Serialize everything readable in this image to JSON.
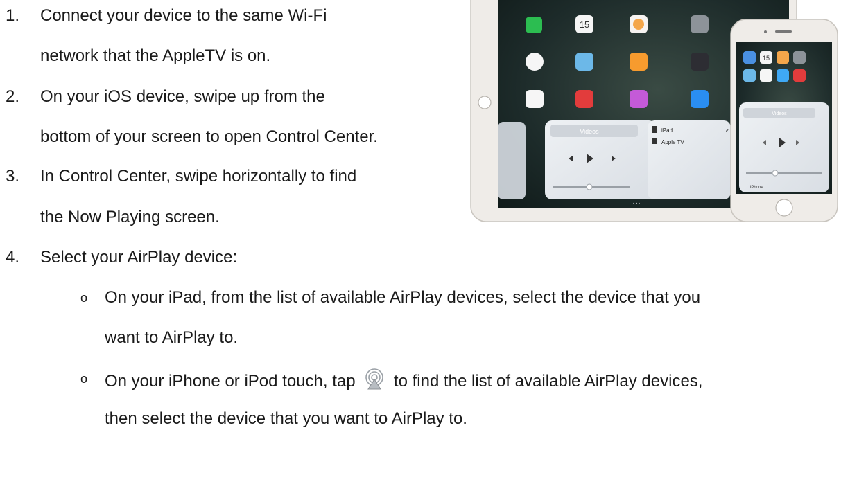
{
  "steps": [
    {
      "number": "1.",
      "lines": [
        "Connect your device to the same Wi-Fi",
        "network that the AppleTV is on."
      ]
    },
    {
      "number": "2.",
      "lines": [
        "On your iOS device, swipe up from the",
        "bottom of your screen to open Control Center."
      ]
    },
    {
      "number": "3.",
      "lines": [
        "In Control Center, swipe horizontally to find",
        "the Now Playing screen."
      ]
    },
    {
      "number": "4.",
      "lines": [
        "Select your AirPlay device:"
      ]
    }
  ],
  "sub_bullets": [
    {
      "bullet": "o",
      "lines": [
        "On your iPad, from the list of available AirPlay devices, select the device that you",
        "want to AirPlay to."
      ]
    },
    {
      "bullet": "o",
      "line1_before": "On your iPhone or iPod touch, tap",
      "line1_after": "to find the list of available AirPlay devices,",
      "line2": "then select the device that you want to AirPlay to."
    }
  ],
  "illustration": {
    "ipad": {
      "icon_labels": [
        "FaceTime",
        "Calendar",
        "Photos",
        "Camera",
        "Clock",
        "Maps",
        "Home",
        "Videos",
        "Reminders",
        "News",
        "iTunes Store",
        "App Store"
      ],
      "calendar_date": "15",
      "now_playing_title": "Videos",
      "airplay_devices": [
        "iPad",
        "Apple TV"
      ],
      "checkmark": "✓",
      "page_dots": "• • •"
    },
    "iphone": {
      "now_playing_title": "Videos",
      "output_device": "iPhone",
      "calendar_date": "15"
    },
    "colors": {
      "wallpaper_dark": "#1d2b2a",
      "device_frame": "#e7e4df",
      "panel": "#e8ebef"
    }
  }
}
